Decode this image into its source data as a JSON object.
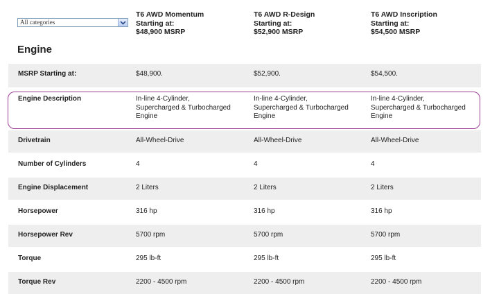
{
  "category_select": {
    "value": "All categories"
  },
  "models": [
    {
      "name": "T6 AWD Momentum",
      "starting": "Starting at:",
      "price": "$48,900 MSRP"
    },
    {
      "name": "T6 AWD R-Design",
      "starting": "Starting at:",
      "price": "$52,900 MSRP"
    },
    {
      "name": "T6 AWD Inscription",
      "starting": "Starting at:",
      "price": "$54,500 MSRP"
    }
  ],
  "section_title": "Engine",
  "rows": [
    {
      "label": "MSRP Starting at:",
      "values": [
        "$48,900.",
        "$52,900.",
        "$54,500."
      ]
    },
    {
      "label": "Engine Description",
      "values": [
        [
          "In-line 4-Cylinder,",
          "Supercharged & Turbocharged",
          "Engine"
        ],
        [
          "In-line 4-Cylinder,",
          "Supercharged & Turbocharged",
          "Engine"
        ],
        [
          "In-line 4-Cylinder,",
          "Supercharged & Turbocharged",
          "Engine"
        ]
      ]
    },
    {
      "label": "Drivetrain",
      "values": [
        "All-Wheel-Drive",
        "All-Wheel-Drive",
        "All-Wheel-Drive"
      ]
    },
    {
      "label": "Number of Cylinders",
      "values": [
        "4",
        "4",
        "4"
      ]
    },
    {
      "label": "Engine Displacement",
      "values": [
        "2 Liters",
        "2 Liters",
        "2 Liters"
      ]
    },
    {
      "label": "Horsepower",
      "values": [
        "316 hp",
        "316 hp",
        "316 hp"
      ]
    },
    {
      "label": "Horsepower Rev",
      "values": [
        "5700 rpm",
        "5700 rpm",
        "5700 rpm"
      ]
    },
    {
      "label": "Torque",
      "values": [
        "295 lb-ft",
        "295 lb-ft",
        "295 lb-ft"
      ]
    },
    {
      "label": "Torque Rev",
      "values": [
        "2200 - 4500 rpm",
        "2200 - 4500 rpm",
        "2200 - 4500 rpm"
      ]
    }
  ],
  "colors": {
    "row_stripe": "#eeeeee",
    "highlight_border": "#9b3a93"
  },
  "icons": {
    "select_arrow": "chevron-down-icon"
  }
}
